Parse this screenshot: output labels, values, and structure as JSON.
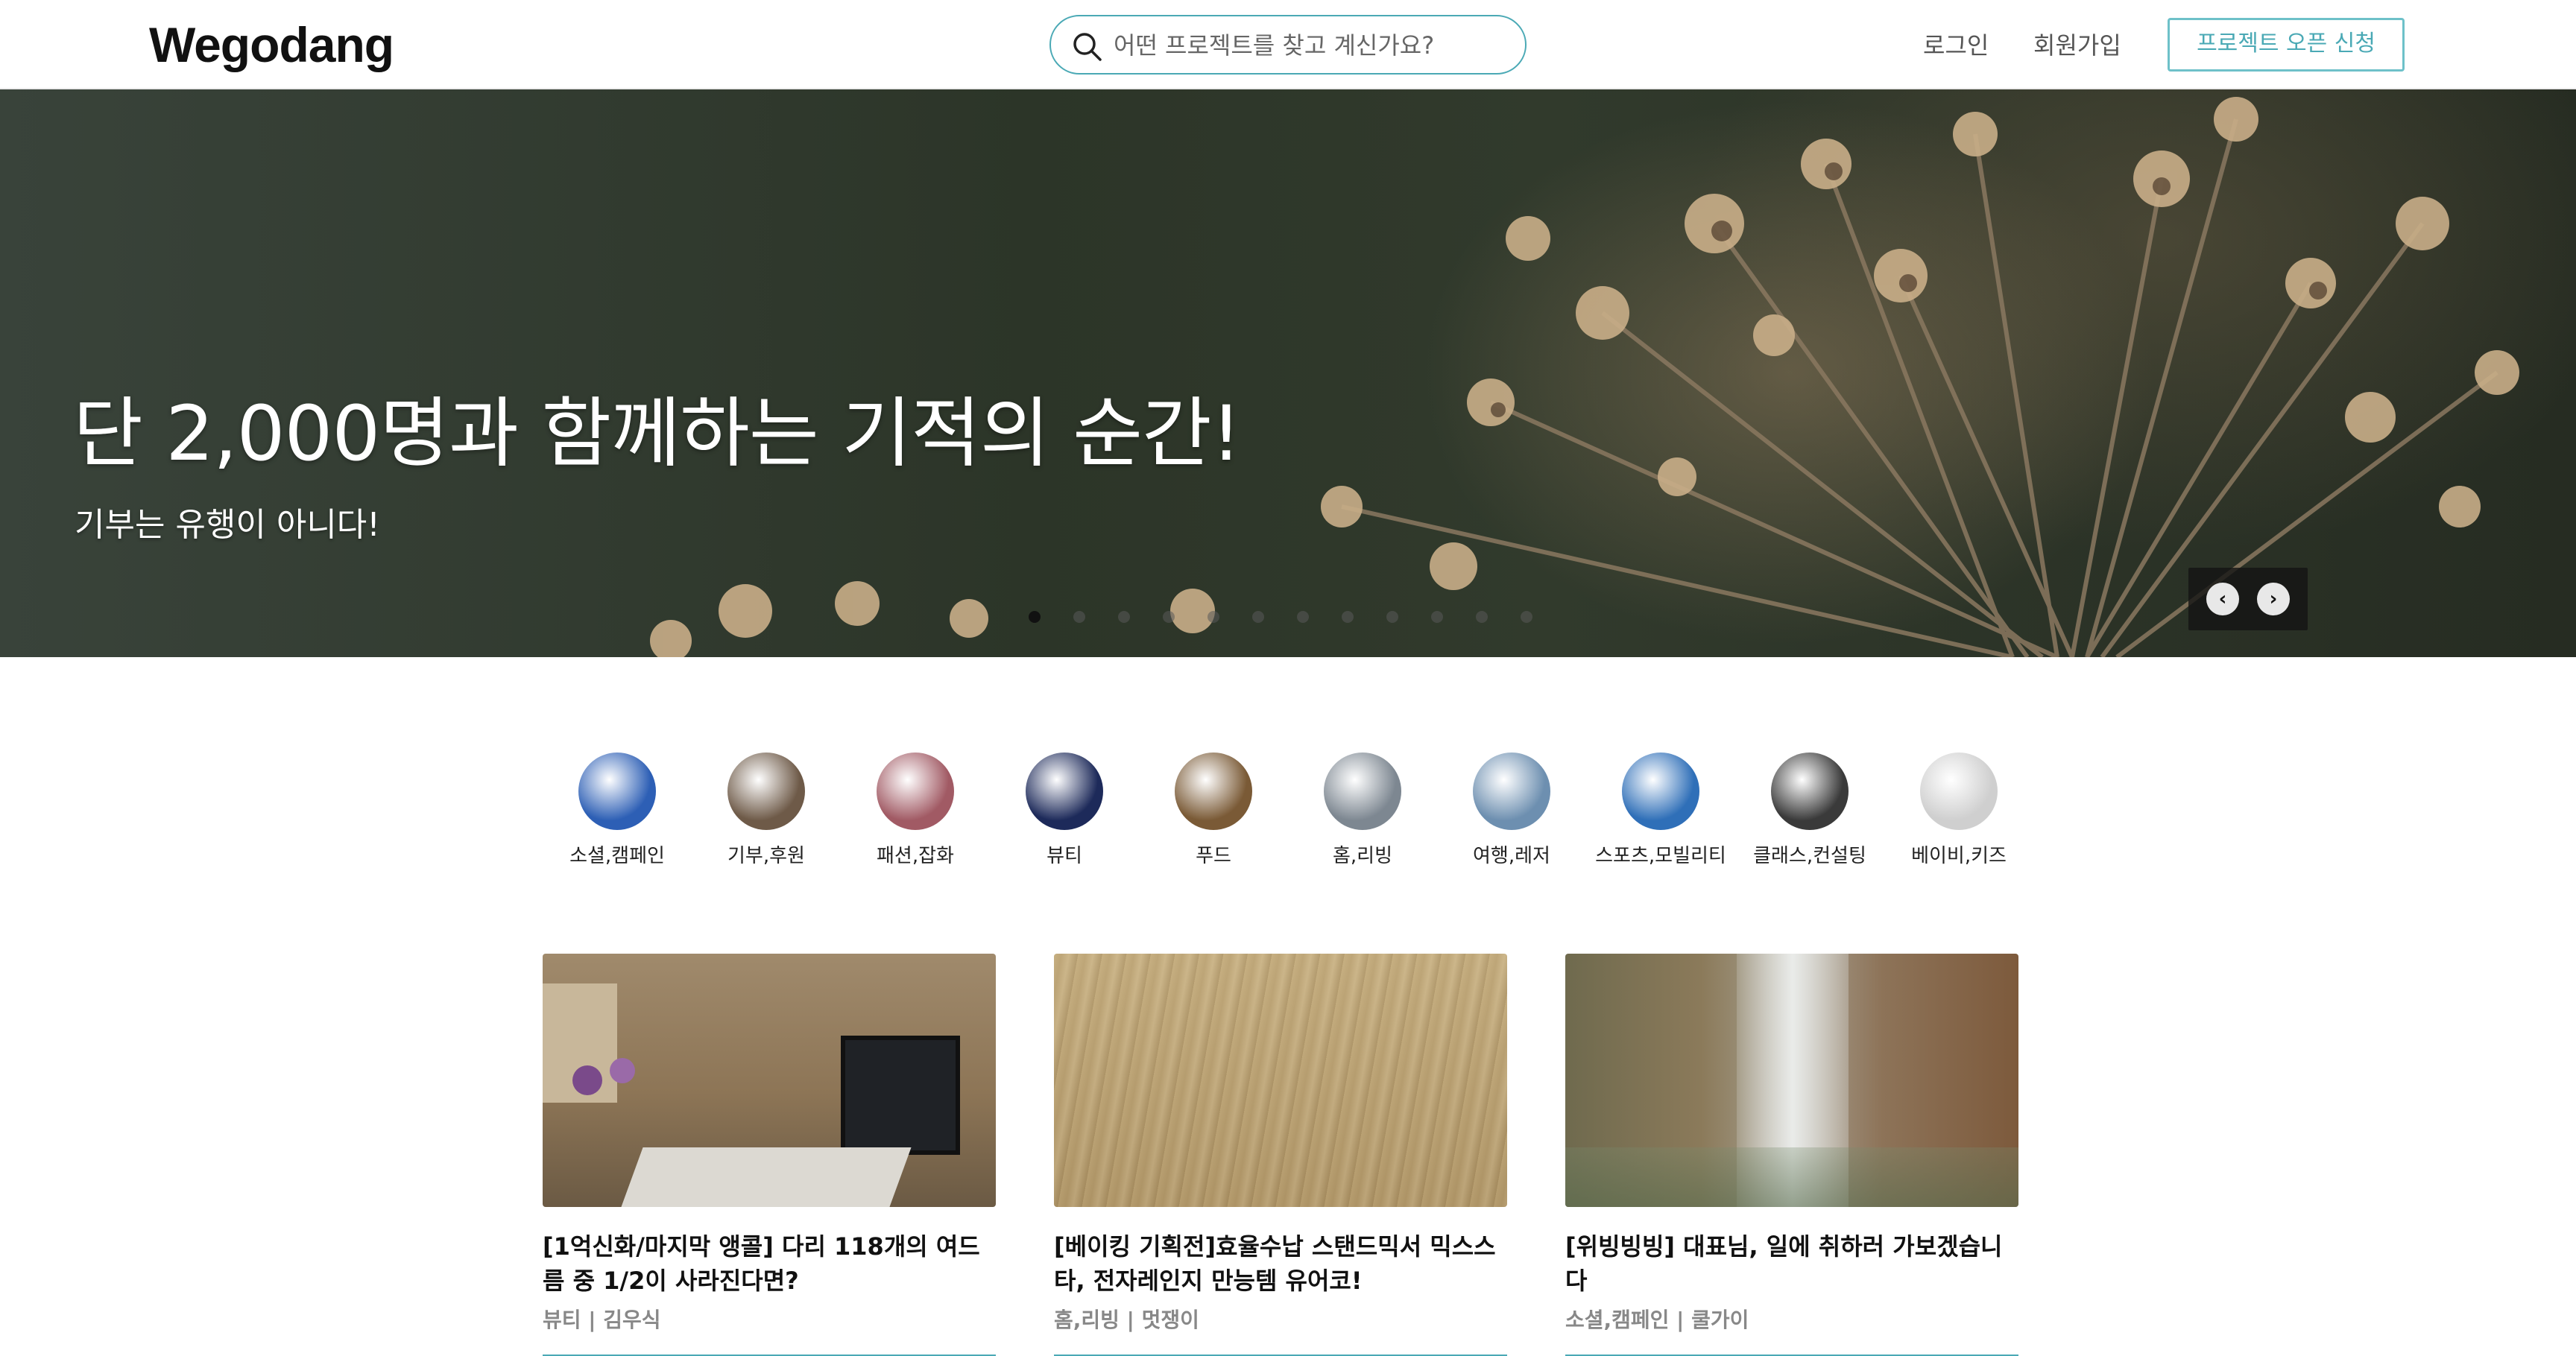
{
  "header": {
    "logo": "Wegodang",
    "search_placeholder": "어떤 프로젝트를 찾고 계신가요?",
    "login": "로그인",
    "signup": "회원가입",
    "open_project": "프로젝트 오픈 신청"
  },
  "hero": {
    "title": "단 2,000명과 함께하는 기적의 순간!",
    "subtitle": "기부는 유행이 아니다!",
    "slide_count": 12,
    "active_slide": 1
  },
  "categories": [
    {
      "label": "소셜,캠페인",
      "color": "#2d5fb5"
    },
    {
      "label": "기부,후원",
      "color": "#6e5a48"
    },
    {
      "label": "패션,잡화",
      "color": "#a15a64"
    },
    {
      "label": "뷰티",
      "color": "#1d2a5a"
    },
    {
      "label": "푸드",
      "color": "#7a5a36"
    },
    {
      "label": "홈,리빙",
      "color": "#7d8791"
    },
    {
      "label": "여행,레저",
      "color": "#6d8fb0"
    },
    {
      "label": "스포츠,모빌리티",
      "color": "#2f6fb8"
    },
    {
      "label": "클래스,컨설팅",
      "color": "#3a3a3a"
    },
    {
      "label": "베이비,키즈",
      "color": "#cfcfcf"
    }
  ],
  "cards": [
    {
      "title": "[1억신화/마지막 앵콜] 다리 118개의 여드름 중 1/2이 사라진다면?",
      "meta": "뷰티 | 김우식"
    },
    {
      "title": "[베이킹 기획전]효율수납 스탠드믹서 믹스스타, 전자레인지 만능템 유어코!",
      "meta": "홈,리빙 | 멋쟁이"
    },
    {
      "title": "[위빙빙빙] 대표님, 일에 취하러 가보겠습니다",
      "meta": "소셜,캠페인 | 쿨가이"
    }
  ],
  "colors": {
    "accent": "#4aa9b5",
    "text": "#222222",
    "muted": "#888888"
  }
}
